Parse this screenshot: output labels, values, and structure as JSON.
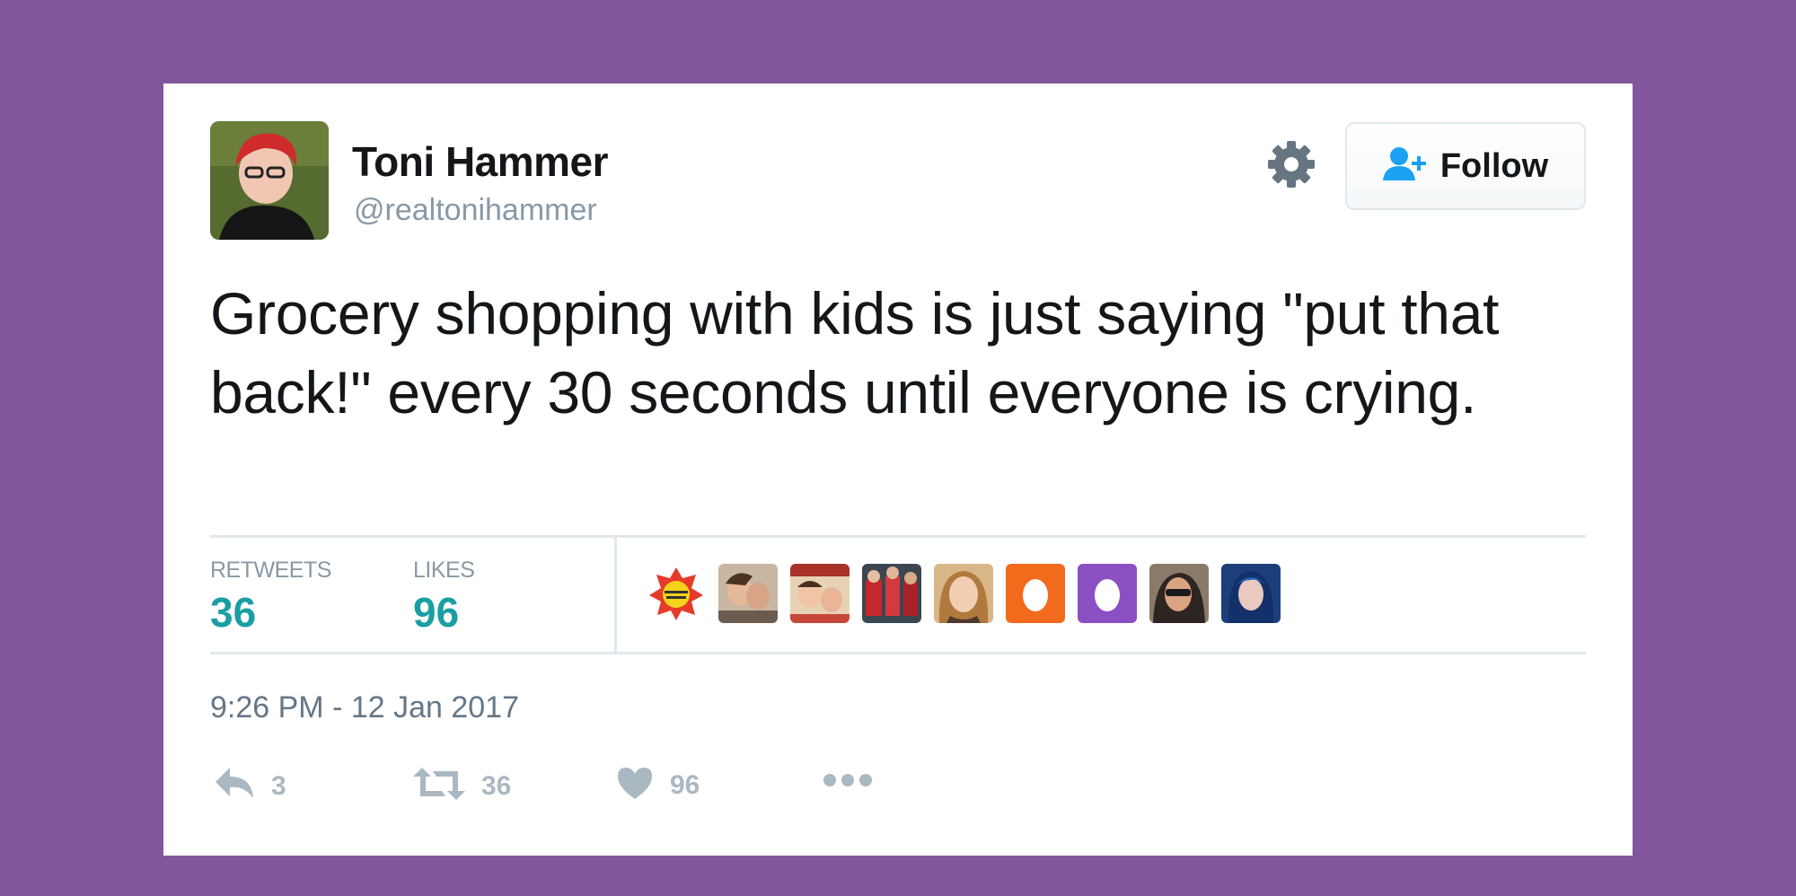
{
  "tweet": {
    "author": {
      "name": "Toni Hammer",
      "handle": "@realtonihammer"
    },
    "follow_label": "Follow",
    "text": "Grocery shopping with kids is just saying \"put that back!\" every 30 seconds until everyone is crying.",
    "stats": {
      "retweets_label": "RETWEETS",
      "retweets_value": "36",
      "likes_label": "LIKES",
      "likes_value": "96"
    },
    "timestamp": "9:26 PM - 12 Jan 2017",
    "actions": {
      "reply_count": "3",
      "retweet_count": "36",
      "like_count": "96"
    },
    "liker_avatars": [
      "sticker-avatar",
      "photo-avatar",
      "photo-avatar",
      "photo-avatar",
      "photo-avatar",
      "egg-avatar",
      "egg-avatar",
      "photo-avatar",
      "photo-avatar"
    ]
  },
  "colors": {
    "background": "#81569c",
    "accent": "#1a9ea3",
    "follow_icon": "#1da1f2",
    "muted": "#8899a6",
    "egg_orange": "#f26a1b",
    "egg_purple": "#8b4fc4"
  },
  "icons": {
    "settings": "gear-icon",
    "follow": "follow-user-icon",
    "reply": "reply-icon",
    "retweet": "retweet-icon",
    "like": "heart-icon",
    "more": "more-dots-icon"
  }
}
